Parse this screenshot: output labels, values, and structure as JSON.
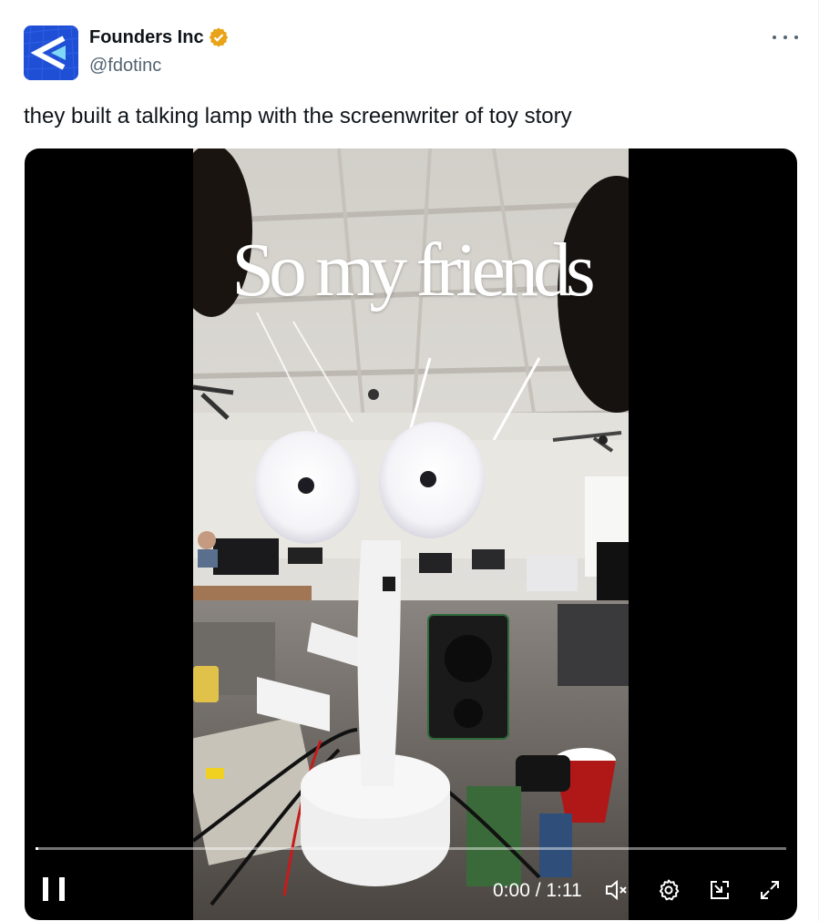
{
  "account": {
    "display_name": "Founders Inc",
    "handle": "@fdotinc",
    "verified": true,
    "avatar_icon": "founders-inc-logo-icon",
    "avatar_color": "#1d4fd6",
    "badge_color": "#e8a317"
  },
  "tweet": {
    "text": "they built a talking lamp with the screenwriter of toy story"
  },
  "video": {
    "caption": "So my friends",
    "current_time": "0:00",
    "duration": "1:11",
    "time_display": "0:00 / 1:11",
    "progress": 0.003,
    "state": "playing",
    "controls": [
      "pause-icon",
      "mute-icon",
      "settings-icon",
      "pip-icon",
      "fullscreen-icon"
    ]
  }
}
